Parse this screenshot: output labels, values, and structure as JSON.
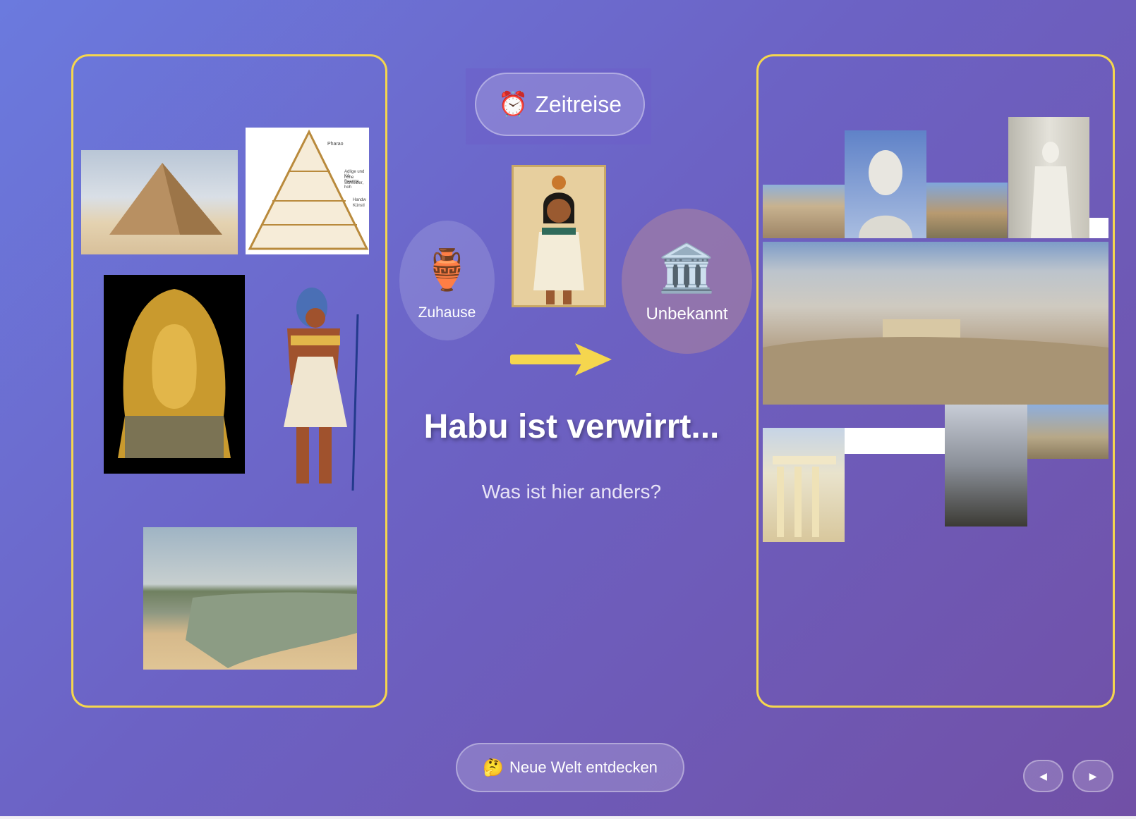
{
  "header": {
    "badge_icon": "alarm-clock",
    "badge_label": "Zeitreise"
  },
  "home": {
    "icon": "🏺",
    "label": "Zuhause"
  },
  "unknown": {
    "icon": "🏛️",
    "label": "Unbekannt"
  },
  "main": {
    "title": "Habu ist verwirrt...",
    "subtitle": "Was ist hier anders?"
  },
  "pyramid_labels": [
    "Pharao",
    "Adlige und Kö",
    "hohe Beamte",
    "Schreiber, hoh",
    "Handw",
    "Künstl"
  ],
  "footer": {
    "discover_icon": "🤔",
    "discover_label": "Neue Welt entdecken",
    "prev_icon": "◀",
    "next_icon": "▶"
  },
  "colors": {
    "accent": "#f5d64e",
    "bg_start": "#6b7ade",
    "bg_end": "#7150a6"
  }
}
